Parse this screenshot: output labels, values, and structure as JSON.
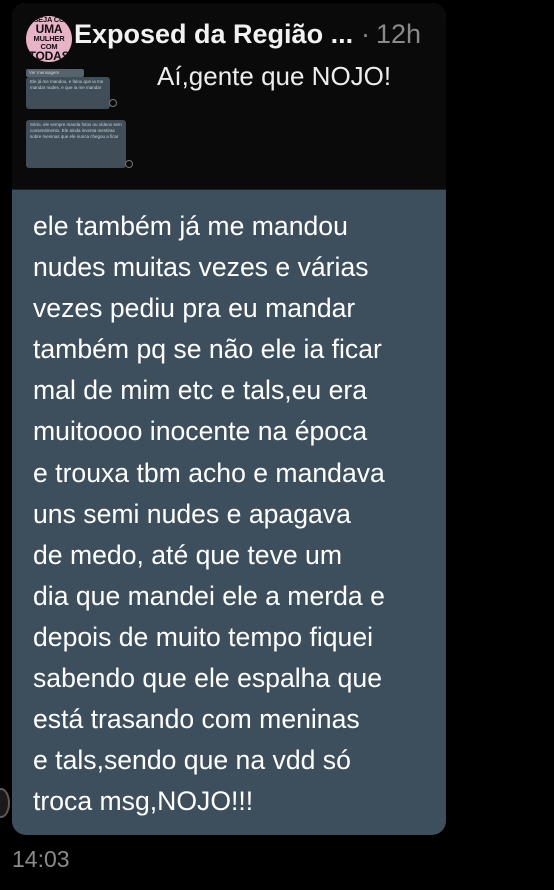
{
  "post": {
    "avatar_lines": [
      "SEJA CO",
      "UMA",
      "MULHER COM",
      "TODAS"
    ],
    "author_name": "Exposed da Região ...",
    "separator": "·",
    "age": "12h",
    "caption": "Aí,gente que NOJO!",
    "thumb_tag": "Ver mensagem",
    "thumb_msg_1": "Ele já me mandou, e falou que ia me mandar nudes, e que ia me mandar",
    "thumb_msg_2": "Sério, ele sempre manda fotos ou vídeos sem consentimento. Ele ainda inventa mentiras sobre meninas que ele nunca chegou a ficar",
    "body": "ele também já me mandou\nnudes muitas vezes e várias\nvezes pediu pra eu mandar\ntambém pq se não ele ia ficar\nmal de mim etc e tals,eu era\nmuitoooo inocente na época\ne trouxa tbm acho e mandava\nuns semi nudes e apagava\nde medo, até que teve um\ndia que mandei ele a merda e\ndepois de muito tempo fiquei\nsabendo que ele espalha que\nestá trasando com meninas\ne tals,sendo que na vdd só\ntroca msg,NOJO!!!"
  },
  "message": {
    "timestamp": "14:03"
  },
  "colors": {
    "bubble": "#3d4f5d",
    "background": "#000000",
    "avatar": "#e8b3c6"
  }
}
